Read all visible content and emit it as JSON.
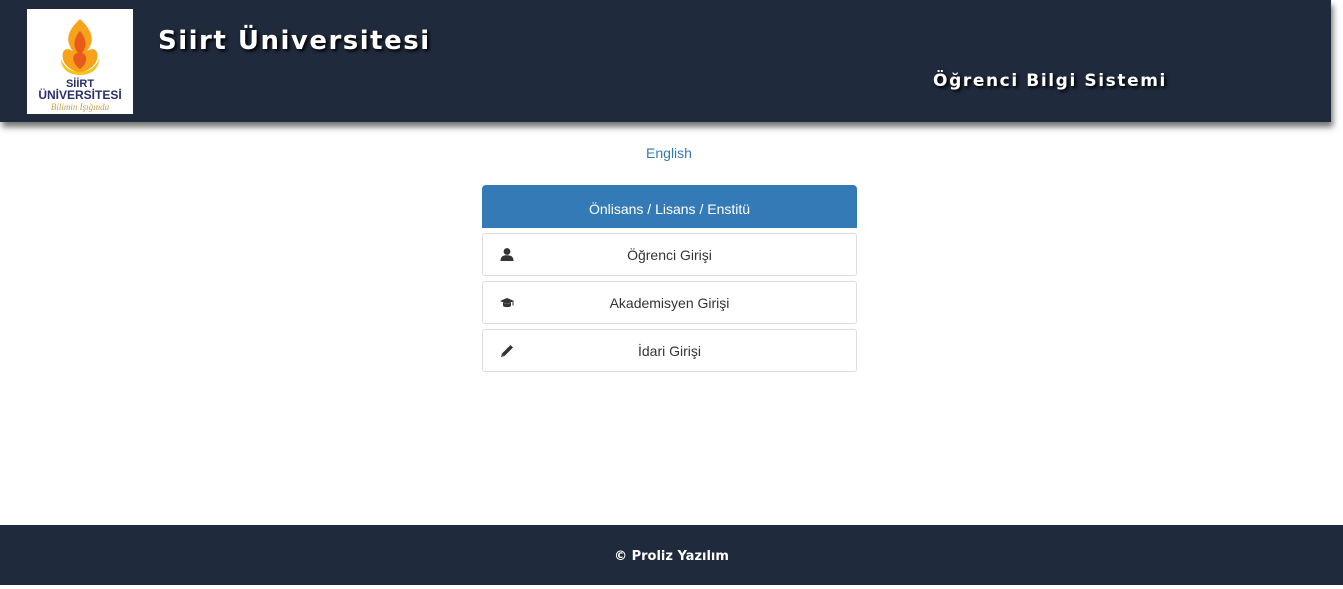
{
  "header": {
    "logo": {
      "line1": "SİİRT",
      "line2": "ÜNİVERSİTESİ",
      "tagline": "Bilimin Işığında"
    },
    "site_title": "Siirt Üniversitesi",
    "system_title": "Öğrenci Bilgi Sistemi",
    "background": "#1f2a3c"
  },
  "language_link": "English",
  "login_panel": {
    "heading": "Önlisans / Lisans / Enstitü",
    "accent": "#337ab7",
    "items": [
      {
        "label": "Öğrenci Girişi",
        "icon": "user-icon"
      },
      {
        "label": "Akademisyen Girişi",
        "icon": "graduation-cap-icon"
      },
      {
        "label": "İdari Girişi",
        "icon": "pencil-icon"
      }
    ]
  },
  "footer": {
    "copyright": "© Proliz Yazılım"
  }
}
